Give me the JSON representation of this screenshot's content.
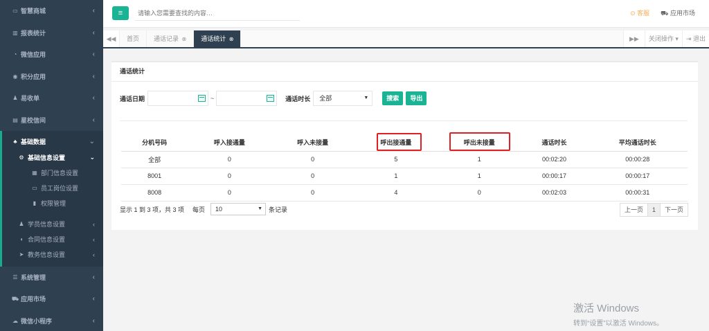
{
  "sidebar": {
    "items_top": [
      {
        "label": "智慧商城",
        "icon": "drive-icon"
      },
      {
        "label": "报表统计",
        "icon": "bar-chart-icon"
      },
      {
        "label": "微信应用",
        "icon": "chat-icon"
      },
      {
        "label": "积分应用",
        "icon": "coin-icon"
      },
      {
        "label": "易收单",
        "icon": "user-plus-icon"
      },
      {
        "label": "星校信间",
        "icon": "doc-icon"
      }
    ],
    "active_group": {
      "label": "基础数据",
      "icon": "sitemap-icon",
      "sub": {
        "label": "基础信息设置",
        "icon": "cogs-icon",
        "items": [
          {
            "label": "部门信息设置",
            "icon": "calendar-icon"
          },
          {
            "label": "员工岗位设置",
            "icon": "id-card-icon"
          },
          {
            "label": "权限管理",
            "icon": "database-icon"
          }
        ]
      },
      "subs_more": [
        {
          "label": "学员信息设置",
          "icon": "users-icon"
        },
        {
          "label": "合同信息设置",
          "icon": "shield-icon"
        },
        {
          "label": "教务信息设置",
          "icon": "rocket-icon"
        }
      ]
    },
    "items_bottom": [
      {
        "label": "系统管理",
        "icon": "tasks-icon"
      },
      {
        "label": "应用市场",
        "icon": "cart-icon"
      },
      {
        "label": "微信小程序",
        "icon": "cloud-icon"
      }
    ]
  },
  "topbar": {
    "menu_icon": "≡",
    "search_placeholder": "请输入您需要查找的内容…",
    "kefu": "客服",
    "market": "应用市场"
  },
  "tabbar": {
    "tabs": [
      {
        "label": "首页",
        "closable": false
      },
      {
        "label": "通话记录",
        "closable": true
      },
      {
        "label": "通话统计",
        "closable": true
      }
    ],
    "close_ops": "关闭操作",
    "exit": "退出"
  },
  "card": {
    "title": "通话统计",
    "filters": {
      "date_label": "通话日期",
      "tilde": "~",
      "duration_label": "通话时长",
      "duration_value": "全部",
      "search_btn": "搜索",
      "export_btn": "导出"
    },
    "table": {
      "headers": [
        "分机号码",
        "呼入接通量",
        "呼入未接量",
        "呼出接通量",
        "呼出未接量",
        "通话时长",
        "平均通话时长"
      ],
      "rows": [
        [
          "全部",
          "0",
          "0",
          "5",
          "1",
          "00:02:20",
          "00:00:28"
        ],
        [
          "8001",
          "0",
          "0",
          "1",
          "1",
          "00:00:17",
          "00:00:17"
        ],
        [
          "8008",
          "0",
          "0",
          "4",
          "0",
          "00:02:03",
          "00:00:31"
        ]
      ]
    },
    "pager": {
      "info": "显示 1 到 3 项，共 3 项",
      "per_page": "每页",
      "page_size": "10",
      "records": "条记录",
      "prev": "上一页",
      "current": "1",
      "next": "下一页"
    }
  },
  "watermark": {
    "line1": "激活 Windows",
    "line2": "转到“设置”以激活 Windows。"
  },
  "colors": {
    "sidebar_bg": "#2f4050",
    "accent": "#1ab394",
    "highlight": "#e02020",
    "kefu": "#f8ac59"
  }
}
